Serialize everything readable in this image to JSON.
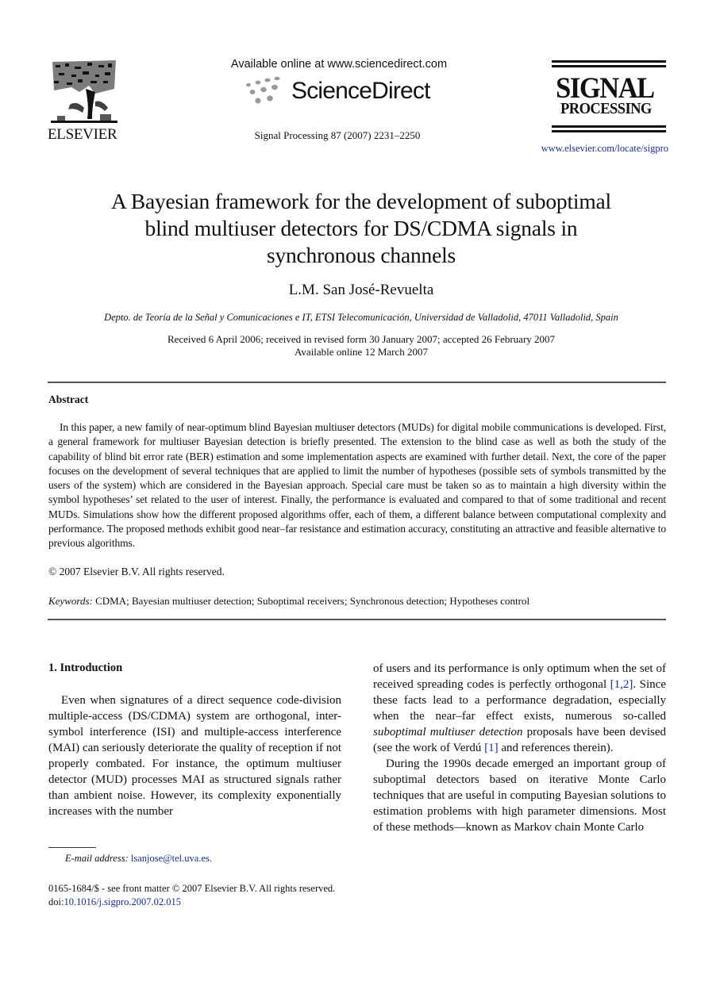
{
  "header": {
    "publisher_wordmark": "ELSEVIER",
    "available_online": "Available online at www.sciencedirect.com",
    "sciencedirect_brand": "ScienceDirect",
    "journal_reference": "Signal Processing 87 (2007) 2231–2250",
    "journal_logo_line1": "SIGNAL",
    "journal_logo_line2": "PROCESSING",
    "journal_url": "www.elsevier.com/locate/sigpro",
    "icons": {
      "publisher_logo": "elsevier-tree-logo",
      "brand_dots": "sciencedirect-dots-logo"
    }
  },
  "article": {
    "title": "A Bayesian framework for the development of suboptimal blind multiuser detectors for DS/CDMA signals in synchronous channels",
    "title_lines": [
      "A Bayesian framework for the development of suboptimal",
      "blind multiuser detectors for DS/CDMA signals in",
      "synchronous channels"
    ],
    "author": "L.M. San José-Revuelta",
    "affiliation": "Depto. de Teoría de la Señal y Comunicaciones e IT, ETSI Telecomunicación, Universidad de Valladolid, 47011 Valladolid, Spain",
    "dates_line1": "Received 6 April 2006; received in revised form 30 January 2007; accepted 26 February 2007",
    "dates_line2": "Available online 12 March 2007"
  },
  "abstract": {
    "heading": "Abstract",
    "body": "In this paper, a new family of near-optimum blind Bayesian multiuser detectors (MUDs) for digital mobile communications is developed. First, a general framework for multiuser Bayesian detection is briefly presented. The extension to the blind case as well as both the study of the capability of blind bit error rate (BER) estimation and some implementation aspects are examined with further detail. Next, the core of the paper focuses on the development of several techniques that are applied to limit the number of hypotheses (possible sets of symbols transmitted by the users of the system) which are considered in the Bayesian approach. Special care must be taken so as to maintain a high diversity within the symbol hypotheses’ set related to the user of interest. Finally, the performance is evaluated and compared to that of some traditional and recent MUDs. Simulations show how the different proposed algorithms offer, each of them, a different balance between computational complexity and performance. The proposed methods exhibit good near–far resistance and estimation accuracy, constituting an attractive and feasible alternative to previous algorithms.",
    "copyright": "© 2007 Elsevier B.V. All rights reserved."
  },
  "keywords": {
    "label": "Keywords:",
    "text": "CDMA; Bayesian multiuser detection; Suboptimal receivers; Synchronous detection; Hypotheses control"
  },
  "introduction": {
    "heading": "1.  Introduction",
    "left_column": "Even when signatures of a direct sequence code-division multiple-access (DS/CDMA) system are orthogonal, inter-symbol interference (ISI) and multiple-access interference (MAI) can seriously deteriorate the quality of reception if not properly combated. For instance, the optimum multiuser detector (MUD) processes MAI as structured signals rather than ambient noise. However, its complexity exponentially increases with the number",
    "right_p1_a": "of users and its performance is only optimum when the set of received spreading codes is perfectly orthogonal ",
    "right_p1_cite1": "[1,2]",
    "right_p1_b": ". Since these facts lead to a performance degradation, especially when the near–far effect exists, numerous so-called ",
    "right_p1_em": "suboptimal multiuser detection",
    "right_p1_c": " proposals have been devised (see the work of Verdú ",
    "right_p1_cite2": "[1]",
    "right_p1_d": " and references therein).",
    "right_p2": "During the 1990s decade emerged an important group of suboptimal detectors based on iterative Monte Carlo techniques that are useful in computing Bayesian solutions to estimation problems with high parameter dimensions. Most of these methods—known as Markov chain Monte Carlo"
  },
  "footnote": {
    "label": "E-mail address:",
    "email": "lsanjose@tel.uva.es."
  },
  "front_matter": {
    "line1": "0165-1684/$ - see front matter © 2007 Elsevier B.V. All rights reserved.",
    "doi_prefix": "doi:",
    "doi": "10.1016/j.sigpro.2007.02.015"
  },
  "colors": {
    "link": "#1a2e8a",
    "text": "#111111",
    "rule": "#555555",
    "sd_dots": "#9a9a9a"
  }
}
